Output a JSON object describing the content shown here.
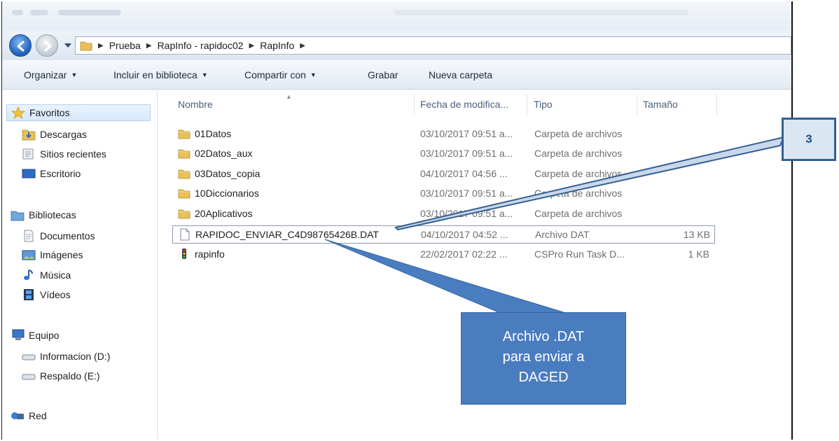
{
  "address": {
    "crumbs": [
      "Prueba",
      "RapInfo - rapidoc02",
      "RapInfo"
    ]
  },
  "toolbar": {
    "organize": "Organizar",
    "include": "Incluir en biblioteca",
    "share": "Compartir con",
    "burn": "Grabar",
    "new_folder": "Nueva carpeta"
  },
  "sidebar": {
    "favorites": "Favoritos",
    "downloads": "Descargas",
    "recent": "Sitios recientes",
    "desktop": "Escritorio",
    "libraries": "Bibliotecas",
    "documents": "Documentos",
    "pictures": "Imágenes",
    "music": "Música",
    "videos": "Vídeos",
    "computer": "Equipo",
    "drive_d": "Informacion (D:)",
    "drive_e": "Respaldo (E:)",
    "network": "Red"
  },
  "columns": {
    "name": "Nombre",
    "date": "Fecha de modifica...",
    "type": "Tipo",
    "size": "Tamaño"
  },
  "files": [
    {
      "name": "01Datos",
      "date": "03/10/2017 09:51 a...",
      "type": "Carpeta de archivos",
      "size": "",
      "icon": "folder-icon"
    },
    {
      "name": "02Datos_aux",
      "date": "03/10/2017 09:51 a...",
      "type": "Carpeta de archivos",
      "size": "",
      "icon": "folder-icon"
    },
    {
      "name": "03Datos_copia",
      "date": "04/10/2017 04:56 ...",
      "type": "Carpeta de archivos",
      "size": "",
      "icon": "folder-icon"
    },
    {
      "name": "10Diccionarios",
      "date": "03/10/2017 09:51 a...",
      "type": "Carpeta de archivos",
      "size": "",
      "icon": "folder-icon"
    },
    {
      "name": "20Aplicativos",
      "date": "03/10/2017 09:51 a...",
      "type": "Carpeta de archivos",
      "size": "",
      "icon": "folder-icon"
    },
    {
      "name": "RAPIDOC_ENVIAR_C4D98765426B.DAT",
      "date": "04/10/2017 04:52 ...",
      "type": "Archivo DAT",
      "size": "13 KB",
      "icon": "document-icon"
    },
    {
      "name": "rapinfo",
      "date": "22/02/2017 02:22 ...",
      "type": "CSPro Run Task D...",
      "size": "1 KB",
      "icon": "traffic-light-icon"
    }
  ],
  "callouts": {
    "number": "3",
    "main_lines": [
      "Archivo .DAT",
      "para enviar a",
      "DAGED"
    ]
  },
  "colors": {
    "callout_fill": "#4a7cc0",
    "callout_border": "#355f93",
    "folder": "#e8c05a"
  }
}
